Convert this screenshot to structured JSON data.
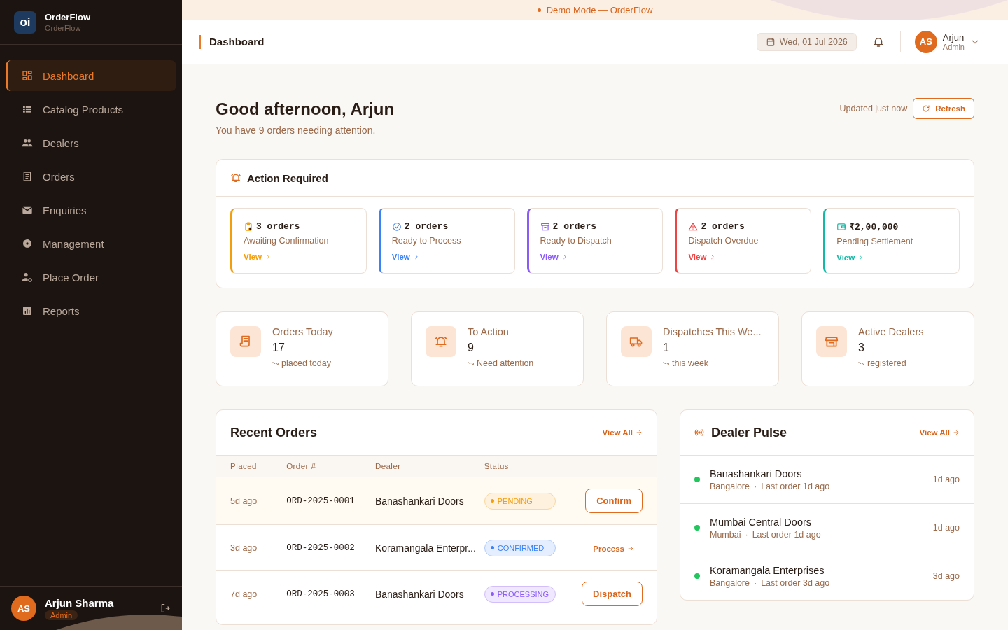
{
  "brand": {
    "logo": "oi",
    "name": "OrderFlow",
    "subtitle": "OrderFlow"
  },
  "sidebar": {
    "items": [
      {
        "label": "Dashboard",
        "selected": true
      },
      {
        "label": "Catalog Products",
        "selected": false
      },
      {
        "label": "Dealers",
        "selected": false
      },
      {
        "label": "Orders",
        "selected": false
      },
      {
        "label": "Enquiries",
        "selected": false
      },
      {
        "label": "Management",
        "selected": false
      },
      {
        "label": "Place Order",
        "selected": false
      },
      {
        "label": "Reports",
        "selected": false
      }
    ],
    "user": {
      "initials": "AS",
      "name": "Arjun Sharma",
      "role": "Admin"
    }
  },
  "banner": "Demo Mode — OrderFlow",
  "header": {
    "title": "Dashboard",
    "date": "Wed, 01 Jul 2026",
    "user": {
      "initials": "AS",
      "name": "Arjun",
      "role": "Admin"
    }
  },
  "greeting": {
    "title": "Good afternoon, Arjun",
    "subtitle": "You have 9 orders needing attention.",
    "updated": "Updated just now",
    "refresh": "Refresh"
  },
  "action_required": {
    "title": "Action Required",
    "cards": [
      {
        "count": "3 orders",
        "label": "Awaiting Confirmation",
        "link": "View",
        "color": "#f59e0b"
      },
      {
        "count": "2 orders",
        "label": "Ready to Process",
        "link": "View",
        "color": "#3b82f6"
      },
      {
        "count": "2 orders",
        "label": "Ready to Dispatch",
        "link": "View",
        "color": "#8b5cf6"
      },
      {
        "count": "2 orders",
        "label": "Dispatch Overdue",
        "link": "View",
        "color": "#ef4444"
      },
      {
        "count": "₹2,00,000",
        "label": "Pending Settlement",
        "link": "View",
        "color": "#14b8a6"
      }
    ]
  },
  "stats": [
    {
      "title": "Orders Today",
      "value": "17",
      "note": "placed today"
    },
    {
      "title": "To Action",
      "value": "9",
      "note": "Need attention"
    },
    {
      "title": "Dispatches This We...",
      "value": "1",
      "note": "this week"
    },
    {
      "title": "Active Dealers",
      "value": "3",
      "note": "registered"
    }
  ],
  "recent_orders": {
    "title": "Recent Orders",
    "view_all": "View All",
    "columns": [
      "Placed",
      "Order #",
      "Dealer",
      "Status"
    ],
    "rows": [
      {
        "placed": "5d ago",
        "order": "ORD-2025-0001",
        "dealer": "Banashankari Doors",
        "status": "PENDING",
        "color": "#f59e0b",
        "action": "Confirm",
        "kind": "button",
        "selected": true
      },
      {
        "placed": "3d ago",
        "order": "ORD-2025-0002",
        "dealer": "Koramangala Enterpr...",
        "status": "CONFIRMED",
        "color": "#3b82f6",
        "action": "Process",
        "kind": "link",
        "selected": false
      },
      {
        "placed": "7d ago",
        "order": "ORD-2025-0003",
        "dealer": "Banashankari Doors",
        "status": "PROCESSING",
        "color": "#8b5cf6",
        "action": "Dispatch",
        "kind": "button",
        "selected": false
      }
    ]
  },
  "dealer_pulse": {
    "title": "Dealer Pulse",
    "view_all": "View All",
    "dealers": [
      {
        "name": "Banashankari Doors",
        "city": "Bangalore",
        "separator": "·",
        "last_order": "Last order 1d ago",
        "ago": "1d ago",
        "color": "#22c55e"
      },
      {
        "name": "Mumbai Central Doors",
        "city": "Mumbai",
        "separator": "·",
        "last_order": "Last order 1d ago",
        "ago": "1d ago",
        "color": "#22c55e"
      },
      {
        "name": "Koramangala Enterprises",
        "city": "Bangalore",
        "separator": "·",
        "last_order": "Last order 3d ago",
        "ago": "3d ago",
        "color": "#22c55e"
      }
    ]
  }
}
